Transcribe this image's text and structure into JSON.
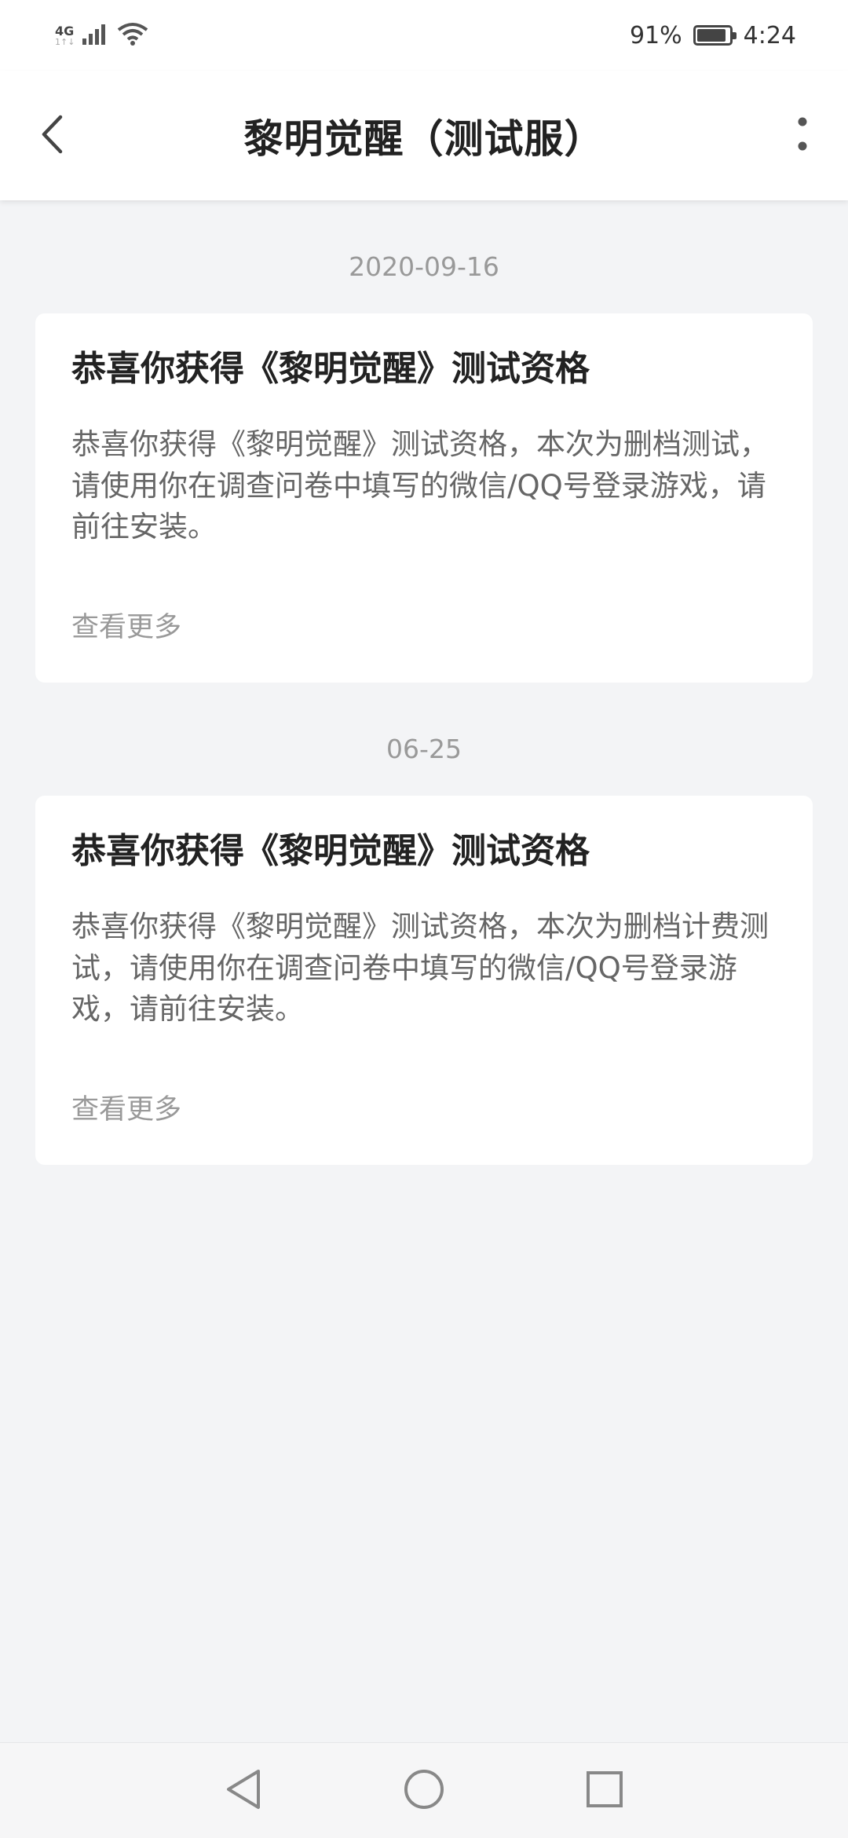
{
  "status_bar": {
    "network": "4G",
    "network_sub": "1↑↓",
    "battery_percent_text": "91%",
    "battery_level": 0.91,
    "time": "4:24"
  },
  "header": {
    "title": "黎明觉醒（测试服）"
  },
  "messages": [
    {
      "date": "2020-09-16",
      "title": "恭喜你获得《黎明觉醒》测试资格",
      "body": "恭喜你获得《黎明觉醒》测试资格，本次为删档测试，请使用你在调查问卷中填写的微信/QQ号登录游戏，请前往安装。",
      "more_label": "查看更多"
    },
    {
      "date": "06-25",
      "title": "恭喜你获得《黎明觉醒》测试资格",
      "body": "恭喜你获得《黎明觉醒》测试资格，本次为删档计费测试，请使用你在调查问卷中填写的微信/QQ号登录游戏，请前往安装。",
      "more_label": "查看更多"
    }
  ],
  "colors": {
    "background": "#f3f4f6",
    "card": "#ffffff",
    "text_primary": "#222222",
    "text_secondary": "#666666",
    "text_muted": "#999999"
  },
  "icons": {
    "back": "chevron-left-icon",
    "more": "more-vertical-icon",
    "nav_back": "triangle-back-icon",
    "nav_home": "circle-home-icon",
    "nav_recent": "square-recent-icon"
  }
}
